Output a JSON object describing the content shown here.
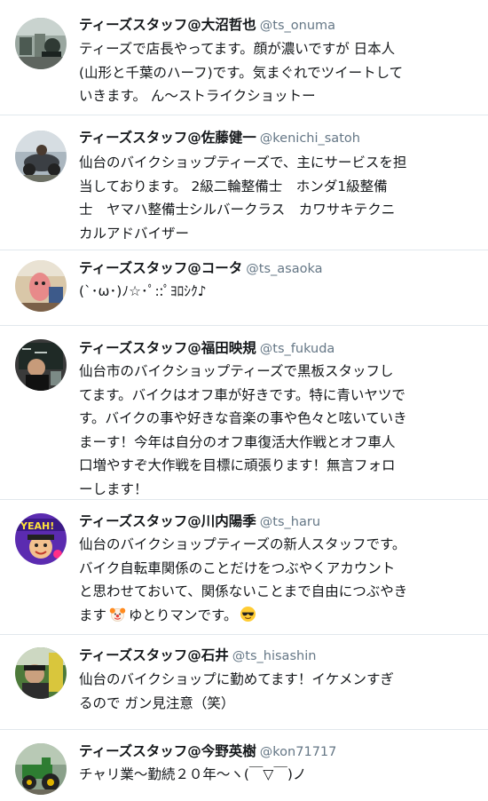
{
  "users": [
    {
      "display_name": "ティーズスタッフ@大沼哲也",
      "handle": "@ts_onuma",
      "bio": "ティーズで店長やってます。顔が濃いですが 日本人\n(山形と千葉のハーフ)です。気まぐれでツイートして\nいきます。 ん〜ストライクショットー"
    },
    {
      "display_name": "ティーズスタッフ@佐藤健一",
      "handle": "@kenichi_satoh",
      "bio": "仙台のバイクショップティーズで、主にサービスを担\n当しております。 2級二輪整備士　ホンダ1級整備\n士　ヤマハ整備士シルバークラス　カワサキテクニ\nカルアドバイザー"
    },
    {
      "display_name": "ティーズスタッフ@コータ",
      "handle": "@ts_asaoka",
      "bio": "(`･ω･)ﾉ☆･ﾟ::ﾟﾖﾛｼｸ♪"
    },
    {
      "display_name": "ティーズスタッフ@福田映規",
      "handle": "@ts_fukuda",
      "bio": "仙台市のバイクショップティーズで黒板スタッフし\nてます。バイクはオフ車が好きです。特に青いヤツで\nす。バイクの事や好きな音楽の事や色々と呟いていき\nまーす！今年は自分のオフ車復活大作戦とオフ車人\n口増やすぞ大作戦を目標に頑張ります！無言フォロ\nーします！"
    },
    {
      "display_name": "ティーズスタッフ@川内陽季",
      "handle": "@ts_haru",
      "bio_lines": [
        "仙台のバイクショップティーズの新人スタッフです。",
        "バイク自転車関係のことだけをつぶやくアカウント",
        "と思わせておいて、関係ないことまで自由につぶやき"
      ],
      "bio_last_a": "ます",
      "emoji_a": "clown-face-emoji",
      "bio_last_b": "ゆとりマンです。",
      "emoji_b": "sunglasses-face-emoji"
    },
    {
      "display_name": "ティーズスタッフ@石井",
      "handle": "@ts_hisashin",
      "bio": "仙台のバイクショップに勤めてます！イケメンすぎ\nるので ガン見注意（笑）"
    },
    {
      "display_name": "ティーズスタッフ@今野英樹",
      "handle": "@kon71717",
      "bio": "チャリ業〜勤続２０年〜ヽ(￣▽￣)ノ"
    }
  ],
  "colors": {
    "name": "#14171a",
    "handle": "#657786",
    "divider": "#e1e8ed"
  }
}
